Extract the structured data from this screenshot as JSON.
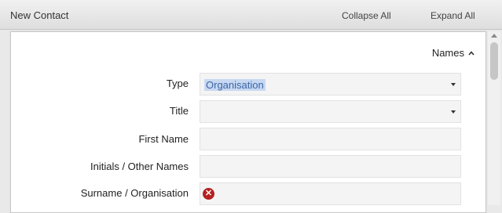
{
  "window": {
    "title": "New Contact",
    "collapse_all": "Collapse All",
    "expand_all": "Expand All"
  },
  "section": {
    "label": "Names",
    "state_icon": "chevron-up-icon"
  },
  "form": {
    "type": {
      "label": "Type",
      "value": "Organisation"
    },
    "title": {
      "label": "Title",
      "value": ""
    },
    "first_name": {
      "label": "First Name",
      "value": ""
    },
    "initials": {
      "label": "Initials / Other Names",
      "value": ""
    },
    "surname": {
      "label": "Surname / Organisation",
      "value": "",
      "error_icon": "error-icon"
    }
  },
  "colors": {
    "error": "#b52020",
    "selection": "#c8d8f2"
  }
}
